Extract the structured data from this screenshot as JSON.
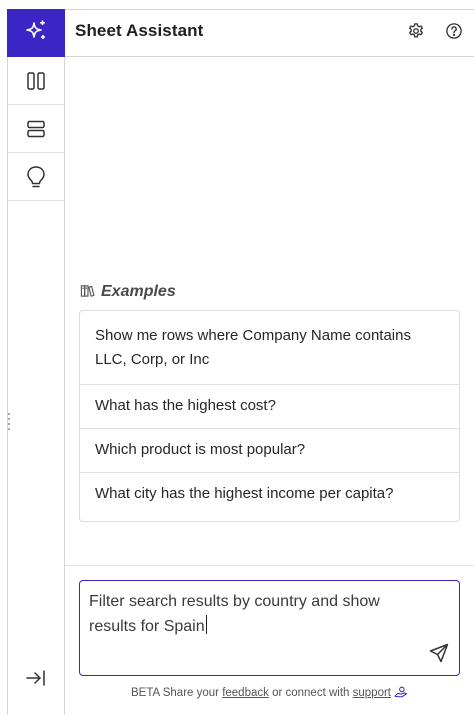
{
  "header": {
    "title": "Sheet Assistant",
    "settings_icon": "gear-icon",
    "help_icon": "help-circle-icon"
  },
  "rail": {
    "top_icon": "sparkle-icon",
    "items": [
      {
        "icon": "columns-icon"
      },
      {
        "icon": "rows-icon"
      },
      {
        "icon": "lightbulb-icon"
      }
    ],
    "collapse_icon": "collapse-right-icon"
  },
  "examples": {
    "label": "Examples",
    "icon": "books-icon",
    "items": [
      "Show me rows where Company Name contains LLC, Corp, or Inc",
      "What has the highest cost?",
      "Which product is most popular?",
      "What city has the highest income per capita?"
    ]
  },
  "input": {
    "value": "Filter search results by country and show results for Spain",
    "send_icon": "send-icon"
  },
  "footer": {
    "prefix": "BETA Share your",
    "feedback": "feedback",
    "middle": "or connect with",
    "support": "support"
  },
  "colors": {
    "accent": "#3b25c4",
    "border": "#d6d6d6"
  }
}
